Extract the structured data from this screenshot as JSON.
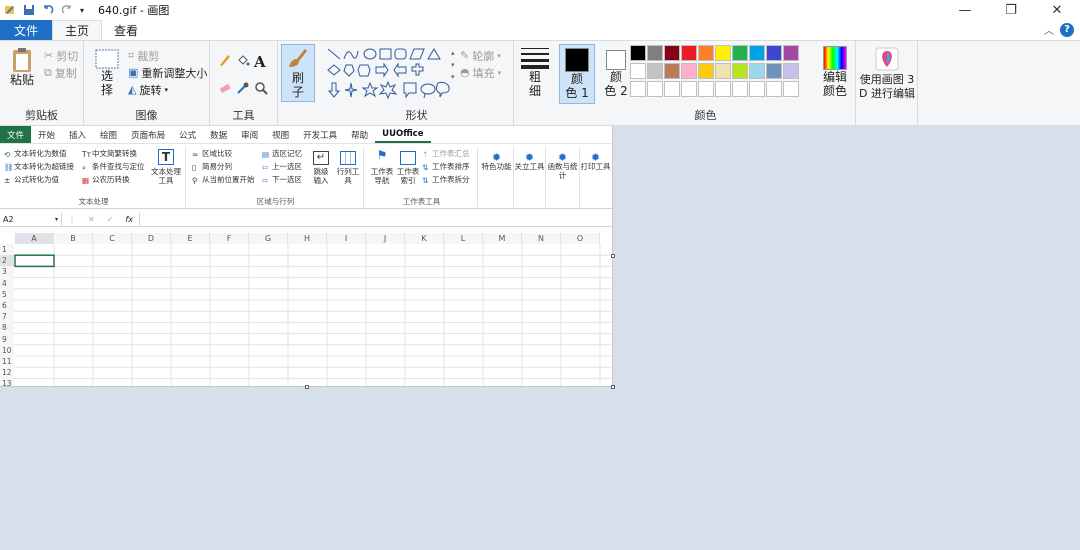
{
  "window": {
    "title": "640.gif - 画图",
    "controls": {
      "minimize": "—",
      "maximize": "❐",
      "close": "✕"
    }
  },
  "tabs": {
    "file": "文件",
    "home": "主页",
    "view": "查看"
  },
  "ribbon": {
    "clipboard": {
      "paste": "粘贴",
      "cut": "剪切",
      "copy": "复制",
      "label": "剪贴板"
    },
    "image": {
      "select_line1": "选",
      "select_line2": "择",
      "crop": "裁剪",
      "resize": "重新调整大小",
      "rotate": "旋转",
      "label": "图像"
    },
    "tools": {
      "label": "工具",
      "text_glyph": "A"
    },
    "brushes": {
      "line1": "刷",
      "line2": "子"
    },
    "shapes": {
      "outline": "轮廓",
      "fill": "填充",
      "label": "形状"
    },
    "size": {
      "line1": "粗",
      "line2": "细"
    },
    "colors": {
      "color1_line1": "颜",
      "color1_line2": "色 1",
      "color2_line1": "颜",
      "color2_line2": "色 2",
      "edit_line1": "编辑",
      "edit_line2": "颜色",
      "label": "颜色",
      "color1": "#000000",
      "color2": "#ffffff",
      "palette_row1": [
        "#000000",
        "#7f7f7f",
        "#880015",
        "#ed1c24",
        "#ff7f27",
        "#fff200",
        "#22b14c",
        "#00a2e8",
        "#3f48cc",
        "#a349a4"
      ],
      "palette_row2": [
        "#ffffff",
        "#c3c3c3",
        "#b97a57",
        "#ffaec9",
        "#ffc90e",
        "#efe4b0",
        "#b5e61d",
        "#99d9ea",
        "#7092be",
        "#c8bfe7"
      ],
      "palette_row3": [
        "#ffffff",
        "#ffffff",
        "#ffffff",
        "#ffffff",
        "#ffffff",
        "#ffffff",
        "#ffffff",
        "#ffffff",
        "#ffffff",
        "#ffffff"
      ]
    },
    "paint3d": {
      "line1": "使用画图 3",
      "line2": "D 进行编辑"
    }
  },
  "excel": {
    "tabs": [
      "文件",
      "开始",
      "插入",
      "绘图",
      "页面布局",
      "公式",
      "数据",
      "审阅",
      "视图",
      "开发工具",
      "帮助",
      "UUOffice"
    ],
    "text_group": {
      "items": [
        "文本转化为数值",
        "文本转化为超链接",
        "公式转化为值",
        "中文简繁转换",
        "条件查找与定位",
        "公农历转换"
      ],
      "big": "文本处理工具",
      "label": "文本处理"
    },
    "region_group": {
      "items": [
        "区域比较",
        "简易分列",
        "从当前位置开始",
        "选区记忆",
        "上一选区",
        "下一选区"
      ],
      "big1": "跳级输入",
      "big2": "行列工具",
      "label": "区域与行列"
    },
    "sheet_group": {
      "big1": "工作表导航",
      "big2": "工作表索引",
      "items": [
        "工作表汇总",
        "工作表排序",
        "工作表拆分"
      ],
      "label": "工作表工具"
    },
    "extra": [
      "特色功能",
      "关立工具",
      "函数与统计",
      "打印工具"
    ],
    "name_box": "A2",
    "fx": "fx",
    "columns": [
      "A",
      "B",
      "C",
      "D",
      "E",
      "F",
      "G",
      "H",
      "I",
      "J",
      "K",
      "L",
      "M",
      "N",
      "O"
    ],
    "rows": [
      "1",
      "2",
      "3",
      "4",
      "5",
      "6",
      "7",
      "8",
      "9",
      "10",
      "11",
      "12",
      "13"
    ]
  }
}
